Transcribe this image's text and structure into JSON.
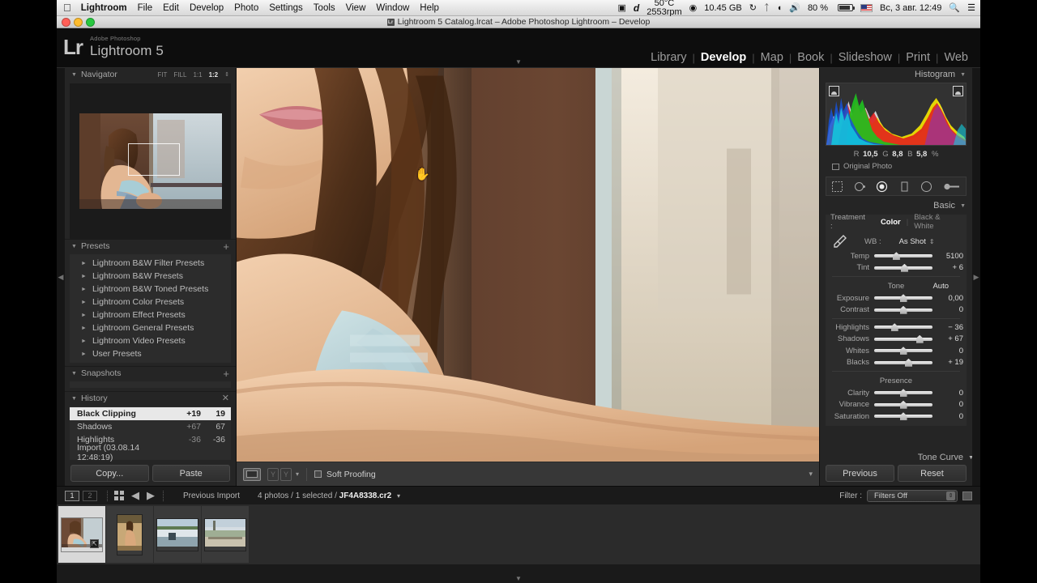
{
  "macbar": {
    "apple_icon": "apple-icon",
    "items": [
      "Lightroom",
      "File",
      "Edit",
      "Develop",
      "Photo",
      "Settings",
      "Tools",
      "View",
      "Window",
      "Help"
    ],
    "status": {
      "screen_icon": "screen-record-icon",
      "dropbox_icon": "d-icon",
      "temp": "50°C",
      "rpm": "2553rpm",
      "disk_icon": "disk-icon",
      "disk_free": "10.45 GB",
      "timemachine_icon": "time-machine-icon",
      "bluetooth_icon": "bluetooth-icon",
      "wifi_icon": "wifi-icon",
      "volume_icon": "volume-icon",
      "battery_percent": "80 %",
      "battery_icon": "battery-icon",
      "flag_icon": "us-flag-icon",
      "clock": "Вс, 3 авг.  12:49",
      "search_icon": "spotlight-search-icon",
      "notifications_icon": "notification-center-icon"
    }
  },
  "titlebar": {
    "app_icon": "lightroom-document-icon",
    "title": "Lightroom 5 Catalog.lrcat – Adobe Photoshop Lightroom – Develop",
    "window_buttons": [
      "close-button",
      "minimize-button",
      "zoom-button"
    ]
  },
  "header": {
    "logo_mark": "Lr",
    "logo_adobe": "Adobe Photoshop",
    "logo_product": "Lightroom 5",
    "modules": [
      {
        "label": "Library",
        "active": false
      },
      {
        "label": "Develop",
        "active": true
      },
      {
        "label": "Map",
        "active": false
      },
      {
        "label": "Book",
        "active": false
      },
      {
        "label": "Slideshow",
        "active": false
      },
      {
        "label": "Print",
        "active": false
      },
      {
        "label": "Web",
        "active": false
      }
    ],
    "separator": "|"
  },
  "left_panel": {
    "navigator": {
      "title": "Navigator",
      "triangle": "▼",
      "zoom_levels": [
        {
          "label": "FIT",
          "active": false
        },
        {
          "label": "FILL",
          "active": false
        },
        {
          "label": "1:1",
          "active": false
        },
        {
          "label": "1:2",
          "active": true
        }
      ],
      "stepper": "⇕"
    },
    "presets": {
      "title": "Presets",
      "triangle": "▼",
      "add": "+",
      "items": [
        "Lightroom B&W Filter Presets",
        "Lightroom B&W Presets",
        "Lightroom B&W Toned Presets",
        "Lightroom Color Presets",
        "Lightroom Effect Presets",
        "Lightroom General Presets",
        "Lightroom Video Presets",
        "User Presets"
      ],
      "item_triangle": "►"
    },
    "snapshots": {
      "title": "Snapshots",
      "triangle": "▼",
      "add": "+"
    },
    "history": {
      "title": "History",
      "triangle": "▼",
      "close": "✕",
      "rows": [
        {
          "label": "Black Clipping",
          "delta": "+19",
          "value": "19",
          "selected": true
        },
        {
          "label": "Shadows",
          "delta": "+67",
          "value": "67",
          "selected": false
        },
        {
          "label": "Highlights",
          "delta": "-36",
          "value": "-36",
          "selected": false
        },
        {
          "label": "Import (03.08.14 12:48:19)",
          "delta": "",
          "value": "",
          "selected": false
        }
      ]
    },
    "buttons": {
      "copy": "Copy...",
      "paste": "Paste"
    }
  },
  "right_panel": {
    "histogram": {
      "title": "Histogram",
      "triangle": "▼",
      "shadow_clip_icon": "shadow-clipping-icon",
      "highlight_clip_icon": "highlight-clipping-icon",
      "readout": {
        "r_label": "R",
        "r": "10,5",
        "g_label": "G",
        "g": "8,8",
        "b_label": "B",
        "b": "5,8",
        "unit": "%"
      },
      "original_photo": "Original Photo"
    },
    "tools": [
      {
        "name": "crop-overlay-tool",
        "active": false
      },
      {
        "name": "spot-removal-tool",
        "active": false
      },
      {
        "name": "red-eye-correction-tool",
        "active": true
      },
      {
        "name": "graduated-filter-tool",
        "active": false
      },
      {
        "name": "radial-filter-tool",
        "active": false
      },
      {
        "name": "adjustment-brush-tool",
        "active": false
      }
    ],
    "basic": {
      "title": "Basic",
      "triangle": "▼",
      "treatment_label": "Treatment :",
      "treatment_color": "Color",
      "treatment_bw": "Black & White",
      "wb_label": "WB :",
      "wb_value": "As Shot",
      "wb_stepper": "⇕",
      "eyedropper_icon": "white-balance-eyedropper-icon",
      "wb_sliders": [
        {
          "name": "Temp",
          "value": "5100",
          "pos": 38
        },
        {
          "name": "Tint",
          "value": "+ 6",
          "pos": 52
        }
      ],
      "tone_label": "Tone",
      "auto_label": "Auto",
      "tone_sliders": [
        {
          "name": "Exposure",
          "value": "0,00",
          "pos": 50
        },
        {
          "name": "Contrast",
          "value": "0",
          "pos": 50
        }
      ],
      "tone_sliders2": [
        {
          "name": "Highlights",
          "value": "− 36",
          "pos": 35
        },
        {
          "name": "Shadows",
          "value": "+ 67",
          "pos": 78
        },
        {
          "name": "Whites",
          "value": "0",
          "pos": 50
        },
        {
          "name": "Blacks",
          "value": "+ 19",
          "pos": 59
        }
      ],
      "presence_label": "Presence",
      "presence_sliders": [
        {
          "name": "Clarity",
          "value": "0",
          "pos": 50
        },
        {
          "name": "Vibrance",
          "value": "0",
          "pos": 50
        },
        {
          "name": "Saturation",
          "value": "0",
          "pos": 50
        }
      ]
    },
    "tone_curve": {
      "title": "Tone Curve",
      "triangle": "▼"
    },
    "buttons": {
      "previous": "Previous",
      "reset": "Reset"
    }
  },
  "toolbar": {
    "loupe_view_icon": "loupe-view-icon",
    "before_after_left": "Y",
    "before_after_right": "Y",
    "caret": "▾",
    "soft_proofing_label": "Soft Proofing",
    "right_caret": "▾"
  },
  "filmstrip": {
    "screen1": "1",
    "screen2": "2",
    "grid_icon": "grid-view-icon",
    "back_arrow": "◀",
    "forward_arrow": "▶",
    "source_label": "Previous Import",
    "count_text": "4 photos / 1 selected / ",
    "selected_file": "JF4A8338.cr2",
    "count_caret": "▾",
    "filter_label": "Filter :",
    "filter_value": "Filters Off",
    "filter_stepper": "⇕",
    "filter_square_icon": "filter-flags-icon",
    "thumbnails": [
      {
        "name": "thumb-JF4A8338",
        "selected": true,
        "badge": "⇱"
      },
      {
        "name": "thumb-portrait-2",
        "selected": false,
        "badge": ""
      },
      {
        "name": "thumb-landscape-3",
        "selected": false,
        "badge": ""
      },
      {
        "name": "thumb-landscape-4",
        "selected": false,
        "badge": ""
      }
    ]
  },
  "colors": {
    "accent": "#ffffff",
    "panel_bg": "#252525",
    "canvas_bg": "#2f2f2f",
    "text": "#bdbdbd"
  },
  "side_arrows": {
    "left": "◀",
    "right": "▶"
  },
  "carets": {
    "top": "▼",
    "bottom": "▼"
  }
}
